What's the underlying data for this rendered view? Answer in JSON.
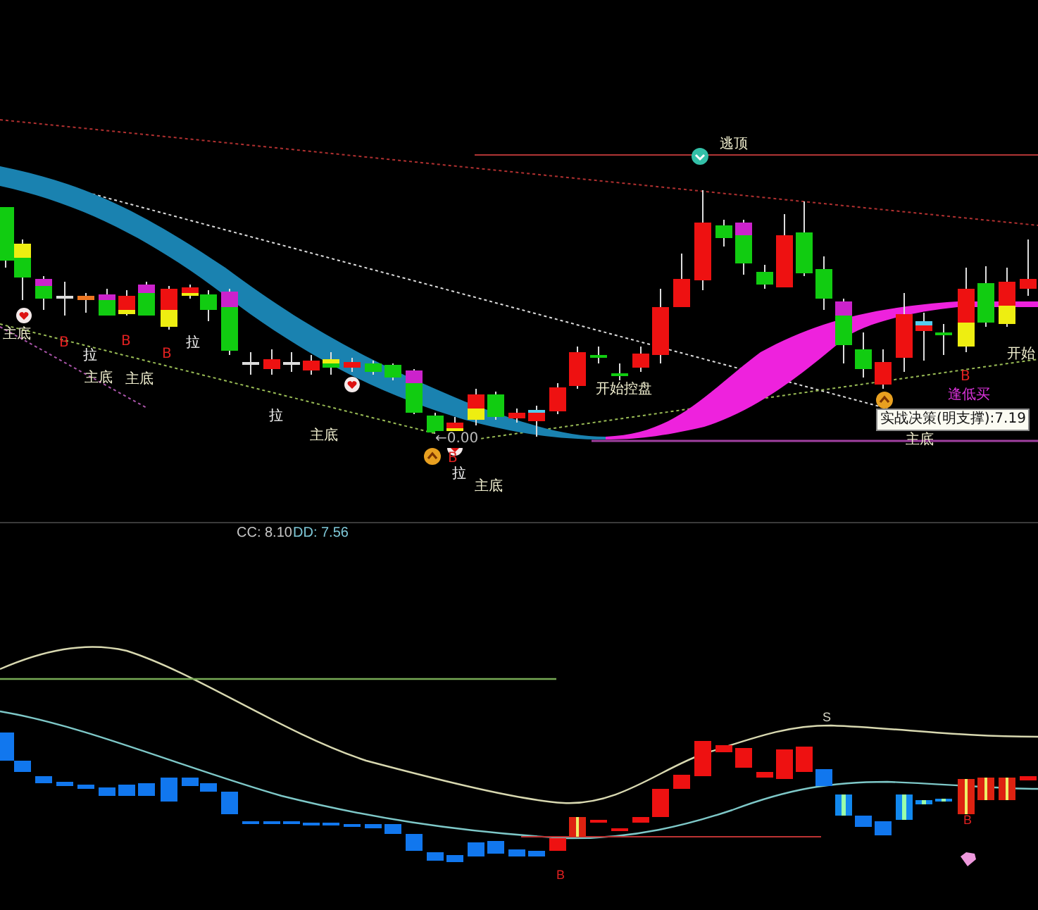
{
  "main_chart": {
    "labels": [
      {
        "text": "逃顶",
        "kind": "signal"
      },
      {
        "text": "主底",
        "kind": "signal"
      },
      {
        "text": "B",
        "kind": "buy"
      },
      {
        "text": "拉",
        "kind": "pull"
      },
      {
        "text": "主底",
        "kind": "signal"
      },
      {
        "text": "B",
        "kind": "buy"
      },
      {
        "text": "主底",
        "kind": "signal"
      },
      {
        "text": "B",
        "kind": "buy"
      },
      {
        "text": "拉",
        "kind": "pull"
      },
      {
        "text": "拉",
        "kind": "pull"
      },
      {
        "text": "主底",
        "kind": "signal"
      },
      {
        "text": "←0.00",
        "kind": "value"
      },
      {
        "text": "B",
        "kind": "buy"
      },
      {
        "text": "拉",
        "kind": "pull"
      },
      {
        "text": "主底",
        "kind": "signal"
      },
      {
        "text": "开始控盘",
        "kind": "signal"
      },
      {
        "text": "B",
        "kind": "buy"
      },
      {
        "text": "逢低买",
        "kind": "dip"
      },
      {
        "text": "主底",
        "kind": "signal"
      },
      {
        "text": "开始",
        "kind": "signal"
      }
    ],
    "tooltip": "实战决策(明支撑):7.19"
  },
  "indicator": {
    "readouts": [
      {
        "text": "CC: 8.10",
        "kind": "cc"
      },
      {
        "text": "DD: 7.56",
        "kind": "dd"
      }
    ],
    "labels": [
      {
        "text": "S",
        "kind": "sell"
      },
      {
        "text": "B",
        "kind": "buy"
      },
      {
        "text": "B",
        "kind": "buy"
      }
    ]
  }
}
